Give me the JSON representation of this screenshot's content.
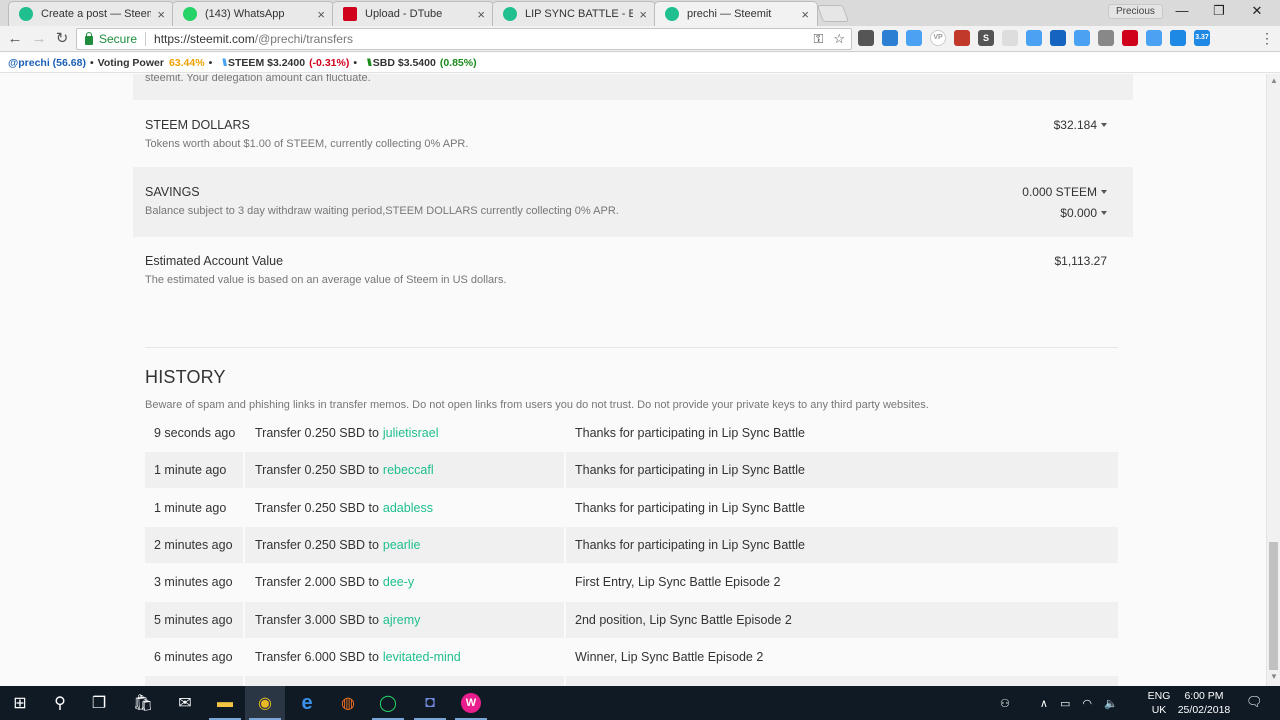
{
  "tabs": [
    {
      "title": "Create a post — Steemit",
      "favicon_color": "#1fbf8f",
      "close": "×"
    },
    {
      "title": "(143) WhatsApp",
      "favicon_color": "#25d366",
      "close": "×"
    },
    {
      "title": "Upload - DTube",
      "favicon_color": "#d0021b",
      "close": "×"
    },
    {
      "title": "LIP SYNC BATTLE - EPISO",
      "favicon_color": "#1fbf8f",
      "close": "×"
    },
    {
      "title": "prechi — Steemit",
      "favicon_color": "#1fbf8f",
      "close": "×"
    }
  ],
  "window": {
    "profile": "Precious",
    "minimize": "—",
    "restore": "❐",
    "close": "✕"
  },
  "address_bar": {
    "back": "←",
    "forward": "→",
    "reload": "↻",
    "secure_label": "Secure",
    "url_host": "https://steemit.com",
    "url_path": "/@prechi/transfers",
    "key_icon": "⚿",
    "star_icon": "☆",
    "menu": "⋮"
  },
  "extensions": [
    {
      "label": "",
      "color": "#555"
    },
    {
      "label": "",
      "color": "#2d7fd3"
    },
    {
      "label": "",
      "color": "#4ba2f2"
    },
    {
      "label": "VP",
      "color": "#bbb"
    },
    {
      "label": "",
      "color": "#c0392b"
    },
    {
      "label": "S",
      "color": "#555"
    },
    {
      "label": "",
      "color": "#ddd"
    },
    {
      "label": "",
      "color": "#4ba2f2"
    },
    {
      "label": "",
      "color": "#1565c0"
    },
    {
      "label": "",
      "color": "#4ba2f2"
    },
    {
      "label": "",
      "color": "#888"
    },
    {
      "label": "",
      "color": "#d0021b"
    },
    {
      "label": "",
      "color": "#4ba2f2"
    },
    {
      "label": "",
      "color": "#1e88e5"
    },
    {
      "label": "3.37",
      "color": "#1e88e5"
    }
  ],
  "ticker": {
    "account": "@prechi (56.68)",
    "voting_label": "Voting Power",
    "voting_value": "63.44%",
    "steem_label": "STEEM $3.2400",
    "steem_change": "(-0.31%)",
    "sbd_label": "SBD $3.5400",
    "sbd_change": "(0.85%)",
    "bullet": "•",
    "steem_glyph": "\\\\\\"
  },
  "wallet": {
    "partial_text": "steemit. Your delegation amount can fluctuate.",
    "steem_dollars": {
      "title": "STEEM DOLLARS",
      "desc": "Tokens worth about $1.00 of STEEM, currently collecting 0% APR.",
      "value": "$32.184"
    },
    "savings": {
      "title": "SAVINGS",
      "desc": "Balance subject to 3 day withdraw waiting period,STEEM DOLLARS currently collecting 0% APR.",
      "value_steem": "0.000 STEEM",
      "value_sbd": "$0.000"
    },
    "estimated": {
      "title": "Estimated Account Value",
      "desc": "The estimated value is based on an average value of Steem in US dollars.",
      "value": "$1,113.27"
    }
  },
  "history": {
    "title": "HISTORY",
    "warning": "Beware of spam and phishing links in transfer memos. Do not open links from users you do not trust. Do not provide your private keys to any third party websites.",
    "rows": [
      {
        "time": "9 seconds ago",
        "op": "Transfer 0.250 SBD to",
        "user": "julietisrael",
        "memo": "Thanks for participating in Lip Sync Battle"
      },
      {
        "time": "1 minute ago",
        "op": "Transfer 0.250 SBD to",
        "user": "rebeccafl",
        "memo": "Thanks for participating in Lip Sync Battle"
      },
      {
        "time": "1 minute ago",
        "op": "Transfer 0.250 SBD to",
        "user": "adabless",
        "memo": "Thanks for participating in Lip Sync Battle"
      },
      {
        "time": "2 minutes ago",
        "op": "Transfer 0.250 SBD to",
        "user": "pearlie",
        "memo": "Thanks for participating in Lip Sync Battle"
      },
      {
        "time": "3 minutes ago",
        "op": "Transfer 2.000 SBD to",
        "user": "dee-y",
        "memo": "First Entry, Lip Sync Battle Episode 2"
      },
      {
        "time": "5 minutes ago",
        "op": "Transfer 3.000 SBD to",
        "user": "ajremy",
        "memo": "2nd position, Lip Sync Battle Episode 2"
      },
      {
        "time": "6 minutes ago",
        "op": "Transfer 6.000 SBD to",
        "user": "levitated-mind",
        "memo": "Winner, Lip Sync Battle Episode 2"
      },
      {
        "time": "",
        "op": "",
        "user": "",
        "memo": ""
      }
    ]
  },
  "taskbar": {
    "apps": [
      {
        "name": "start",
        "glyph": "⊞",
        "color": "#ffffff"
      },
      {
        "name": "search",
        "glyph": "⚲",
        "color": "#ffffff"
      },
      {
        "name": "task-view",
        "glyph": "❐",
        "color": "#ffffff"
      },
      {
        "name": "store",
        "glyph": "🛍",
        "color": "#ffffff"
      },
      {
        "name": "mail",
        "glyph": "✉",
        "color": "#ffffff"
      },
      {
        "name": "file-explorer",
        "glyph": "▬",
        "color": "#f4c542"
      },
      {
        "name": "chrome",
        "glyph": "◉",
        "color": "#e8b923"
      },
      {
        "name": "edge",
        "glyph": "e",
        "color": "#3b8fe8"
      },
      {
        "name": "firefox",
        "glyph": "◍",
        "color": "#f27121"
      },
      {
        "name": "whatsapp",
        "glyph": "◯",
        "color": "#25d366"
      },
      {
        "name": "discord",
        "glyph": "◘",
        "color": "#7289da"
      },
      {
        "name": "w-app",
        "glyph": "W",
        "color": "#e91e8c"
      }
    ],
    "tray": {
      "people": "⚇",
      "chevron": "∧",
      "battery": "▭",
      "wifi": "◠",
      "volume": "🔈"
    },
    "lang_1": "ENG",
    "lang_2": "UK",
    "time": "6:00 PM",
    "date": "25/02/2018",
    "notification": "🗨"
  }
}
